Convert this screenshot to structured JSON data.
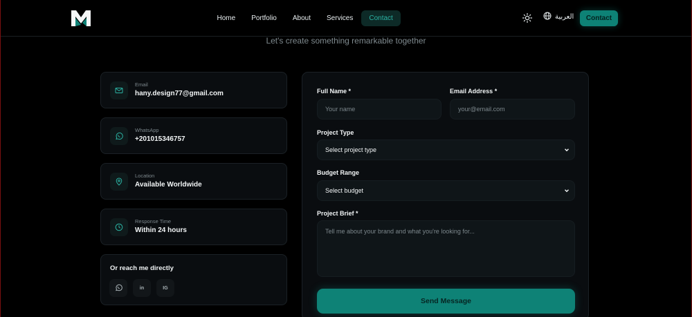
{
  "nav": {
    "links": [
      "Home",
      "Portfolio",
      "About",
      "Services",
      "Contact"
    ],
    "active_index": 4,
    "language_label": "العربية",
    "cta_label": "Contact"
  },
  "subtitle": "Let's create something remarkable together",
  "contact_info": [
    {
      "icon": "mail-icon",
      "label": "Email",
      "value": "hany.design77@gmail.com"
    },
    {
      "icon": "whatsapp-icon",
      "label": "WhatsApp",
      "value": "+201015346757"
    },
    {
      "icon": "location-pin-icon",
      "label": "Location",
      "value": "Available Worldwide"
    },
    {
      "icon": "clock-icon",
      "label": "Response Time",
      "value": "Within 24 hours"
    }
  ],
  "direct": {
    "title": "Or reach me directly",
    "socials": [
      {
        "icon": "whatsapp-icon",
        "text": ""
      },
      {
        "icon": "linkedin-icon",
        "text": "in"
      },
      {
        "icon": "instagram-icon",
        "text": "IG"
      }
    ]
  },
  "form": {
    "full_name": {
      "label": "Full Name *",
      "placeholder": "Your name"
    },
    "email": {
      "label": "Email Address *",
      "placeholder": "your@email.com"
    },
    "project_type": {
      "label": "Project Type",
      "value": "Select project type"
    },
    "budget": {
      "label": "Budget Range",
      "value": "Select budget"
    },
    "brief": {
      "label": "Project Brief *",
      "placeholder": "Tell me about your brand and what you're looking for..."
    },
    "submit_label": "Send Message"
  },
  "colors": {
    "accent": "#0e8276",
    "accent_text": "#2bb3a4",
    "background": "#000000",
    "card": "#0a0d10"
  }
}
